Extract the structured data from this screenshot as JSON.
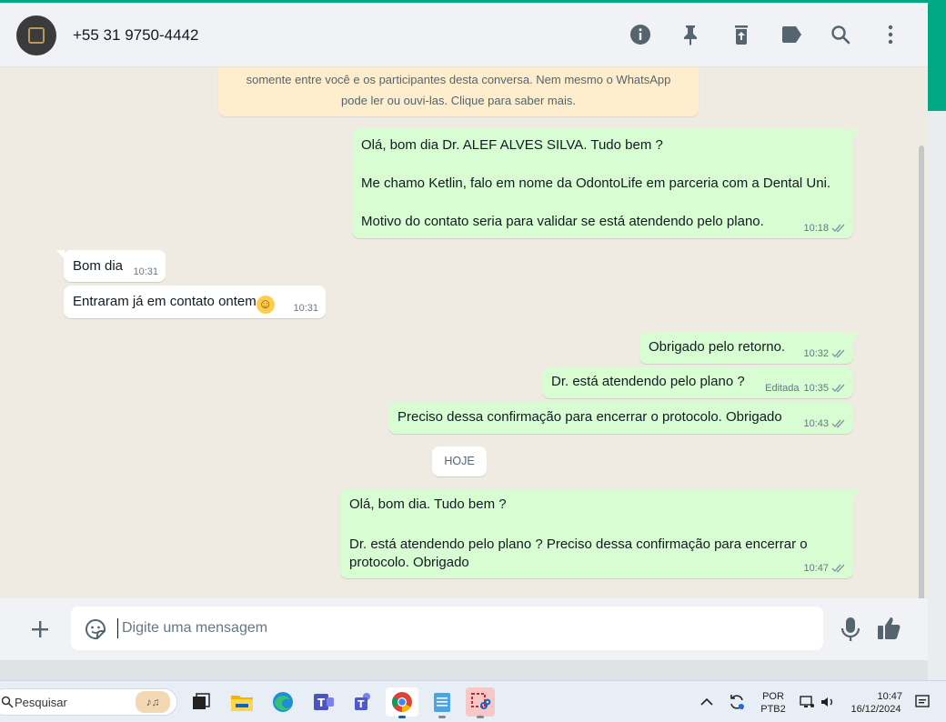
{
  "header": {
    "contact": "+55 31 9750-4442",
    "icons": [
      "info-icon",
      "pin-icon",
      "clear-chat-icon",
      "label-icon",
      "search-icon",
      "menu-icon"
    ]
  },
  "encryption_notice": {
    "line1": "somente entre você e os participantes desta conversa. Nem mesmo o WhatsApp",
    "line2": "pode ler ou ouvi-las. Clique para saber mais."
  },
  "messages": [
    {
      "dir": "out",
      "lines": [
        "Olá, bom dia Dr. ALEF ALVES SILVA. Tudo bem ?",
        "",
        "Me chamo Ketlin, falo em nome da OdontoLife em parceria com a Dental Uni.",
        "",
        "Motivo do contato seria para validar se está atendendo pelo plano."
      ],
      "time": "10:18"
    },
    {
      "dir": "in",
      "text": "Bom dia",
      "time": "10:31"
    },
    {
      "dir": "in",
      "text": "Entraram já em contato ontem",
      "emoji": "☺",
      "time": "10:31"
    },
    {
      "dir": "out",
      "text": "Obrigado pelo retorno.",
      "time": "10:32"
    },
    {
      "dir": "out",
      "text": "Dr. está atendendo pelo plano ?",
      "edited": "Editada",
      "time": "10:35"
    },
    {
      "dir": "out",
      "text": "Preciso dessa confirmação para encerrar o protocolo. Obrigado",
      "time": "10:43"
    },
    {
      "dir": "out",
      "lines": [
        "Olá, bom dia. Tudo bem ?",
        "",
        "Dr. está atendendo pelo plano ? Preciso dessa confirmação para encerrar o",
        "protocolo. Obrigado"
      ],
      "time": "10:47"
    }
  ],
  "day_chip": "HOJE",
  "composer": {
    "placeholder": "Digite uma mensagem"
  },
  "taskbar": {
    "search_label": "Pesquisar",
    "lang_top": "POR",
    "lang_bottom": "PTB2",
    "time": "10:47",
    "date": "16/12/2024"
  },
  "colors": {
    "accent": "#00a884",
    "outgoing_bubble": "#d9fdd3",
    "incoming_bubble": "#ffffff",
    "chat_bg": "#efeae2",
    "notice_bg": "#ffeecd",
    "tick_read": "#8696a0"
  }
}
